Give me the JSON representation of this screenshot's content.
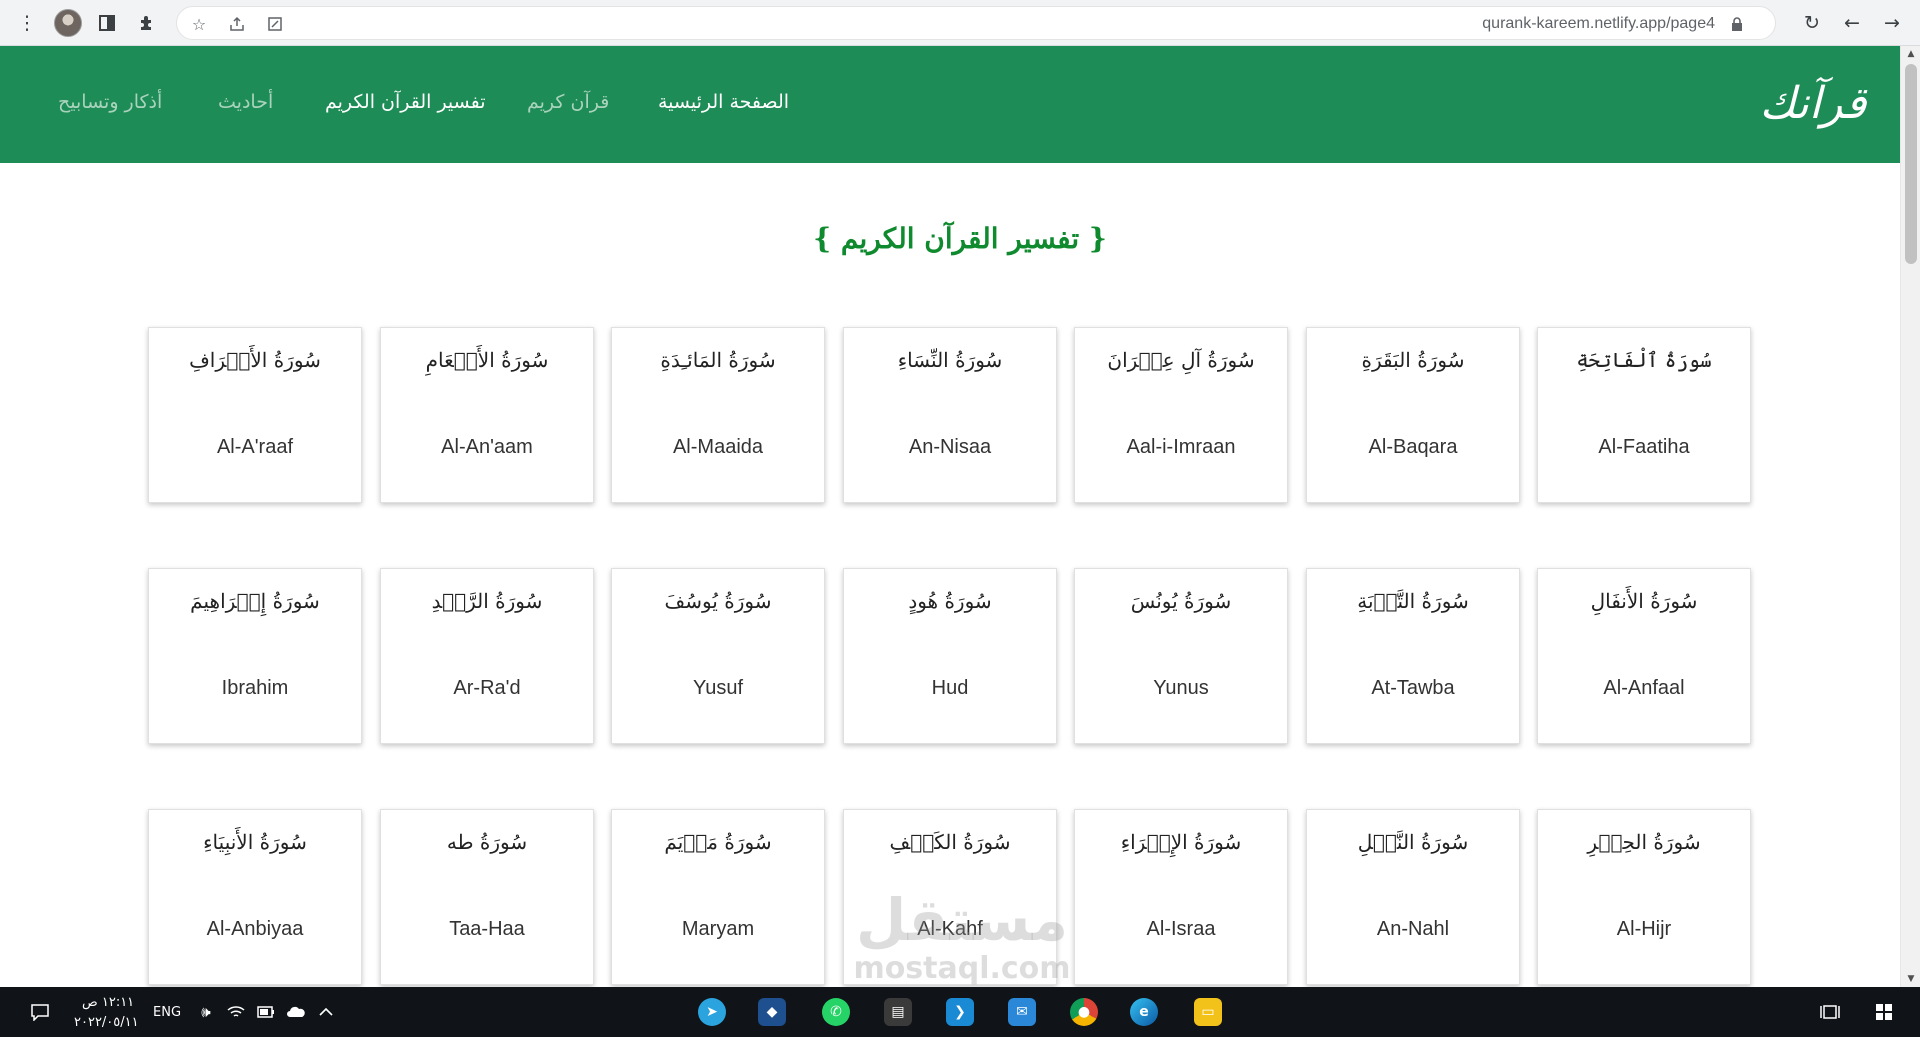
{
  "browser": {
    "url": "qurank-kareem.netlify.app/page4",
    "icons": [
      "menu-dots-icon",
      "profile-avatar",
      "sidebar-icon",
      "extensions-icon",
      "bookmark-star-icon",
      "share-icon",
      "screenshot-icon",
      "lock-icon",
      "reload-icon",
      "back-icon",
      "forward-icon"
    ]
  },
  "site": {
    "logo_text": "قرآنك",
    "nav": [
      {
        "label": "الصفحة الرئيسية",
        "active": true
      },
      {
        "label": "قرآن كريم",
        "active": false
      },
      {
        "label": "تفسير القرآن الكريم",
        "active": true
      },
      {
        "label": "أحاديث",
        "active": false
      },
      {
        "label": "أذكار وتسابيح",
        "active": false
      }
    ],
    "colors": {
      "navbar": "#1e8c57",
      "heading": "#0f8a2e"
    }
  },
  "page": {
    "heading": "{ تفسير القرآن الكريم }"
  },
  "surahs": [
    [
      {
        "ar": "سُورَةُ ٱلْفَاتِحَةِ",
        "en": "Al-Faatiha"
      },
      {
        "ar": "سُورَةُ البَقَرَةِ",
        "en": "Al-Baqara"
      },
      {
        "ar": "سُورَةُ آلِ عِمۡرَانَ",
        "en": "Aal-i-Imraan"
      },
      {
        "ar": "سُورَةُ النِّسَاءِ",
        "en": "An-Nisaa"
      },
      {
        "ar": "سُورَةُ المَائـِدَةِ",
        "en": "Al-Maaida"
      },
      {
        "ar": "سُورَةُ الأَنۡعَامِ",
        "en": "Al-An'aam"
      },
      {
        "ar": "سُورَةُ الأَعۡرَافِ",
        "en": "Al-A'raaf"
      }
    ],
    [
      {
        "ar": "سُورَةُ الأَنفَالِ",
        "en": "Al-Anfaal"
      },
      {
        "ar": "سُورَةُ التَّوۡبَةِ",
        "en": "At-Tawba"
      },
      {
        "ar": "سُورَةُ يُونُسَ",
        "en": "Yunus"
      },
      {
        "ar": "سُورَةُ هُودٍ",
        "en": "Hud"
      },
      {
        "ar": "سُورَةُ يُوسُفَ",
        "en": "Yusuf"
      },
      {
        "ar": "سُورَةُ الرَّعۡدِ",
        "en": "Ar-Ra'd"
      },
      {
        "ar": "سُورَةُ إِبۡرَاهِيمَ",
        "en": "Ibrahim"
      }
    ],
    [
      {
        "ar": "سُورَةُ الحِجۡرِ",
        "en": "Al-Hijr"
      },
      {
        "ar": "سُورَةُ النَّحۡلِ",
        "en": "An-Nahl"
      },
      {
        "ar": "سُورَةُ الإِسۡرَاءِ",
        "en": "Al-Israa"
      },
      {
        "ar": "سُورَةُ الكَهۡفِ",
        "en": "Al-Kahf"
      },
      {
        "ar": "سُورَةُ مَرۡيَمَ",
        "en": "Maryam"
      },
      {
        "ar": "سُورَةُ طه",
        "en": "Taa-Haa"
      },
      {
        "ar": "سُورَةُ الأَنبِيَاءِ",
        "en": "Al-Anbiyaa"
      }
    ]
  ],
  "watermark": {
    "arabic": "مستقل",
    "latin": "mostaql.com"
  },
  "taskbar": {
    "time": "١٢:١١ ص",
    "date": "٢٠٢٢/٠٥/١١",
    "language": "ENG",
    "apps": [
      "telegram-icon",
      "virtualbox-icon",
      "whatsapp-icon",
      "notes-icon",
      "vscode-icon",
      "mail-icon",
      "chrome-icon",
      "edge-icon",
      "file-explorer-icon"
    ]
  }
}
